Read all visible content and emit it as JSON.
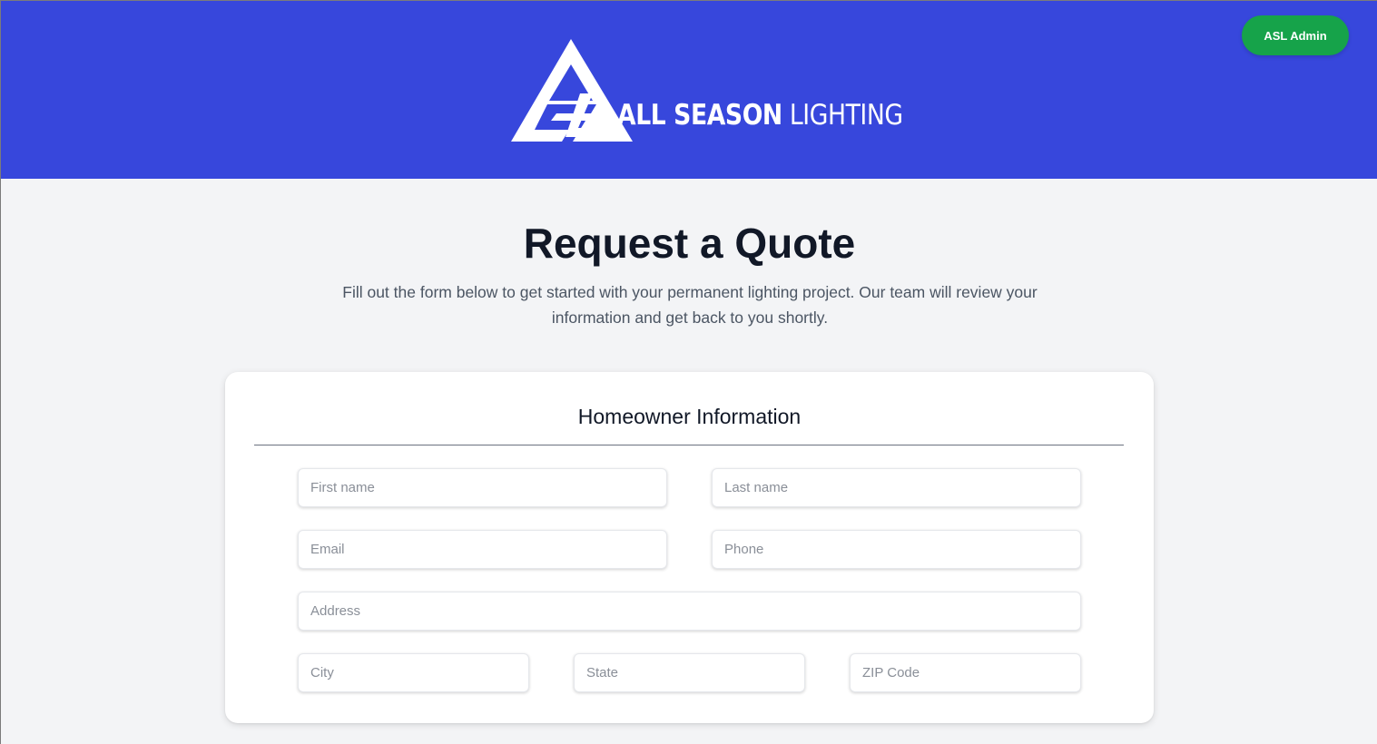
{
  "header": {
    "logo_text_bold": "ALL SEASON",
    "logo_text_light": "LIGHTING",
    "admin_button": "ASL Admin",
    "colors": {
      "background": "#3747dc",
      "admin_button": "#16a34a"
    }
  },
  "main": {
    "title": "Request a Quote",
    "subtitle": "Fill out the form below to get started with your permanent lighting project. Our team will review your information and get back to you shortly."
  },
  "form": {
    "section_title": "Homeowner Information",
    "fields": {
      "first_name": {
        "placeholder": "First name",
        "value": ""
      },
      "last_name": {
        "placeholder": "Last name",
        "value": ""
      },
      "email": {
        "placeholder": "Email",
        "value": ""
      },
      "phone": {
        "placeholder": "Phone",
        "value": ""
      },
      "address": {
        "placeholder": "Address",
        "value": ""
      },
      "city": {
        "placeholder": "City",
        "value": ""
      },
      "state": {
        "placeholder": "State",
        "value": ""
      },
      "zip": {
        "placeholder": "ZIP Code",
        "value": ""
      }
    }
  }
}
